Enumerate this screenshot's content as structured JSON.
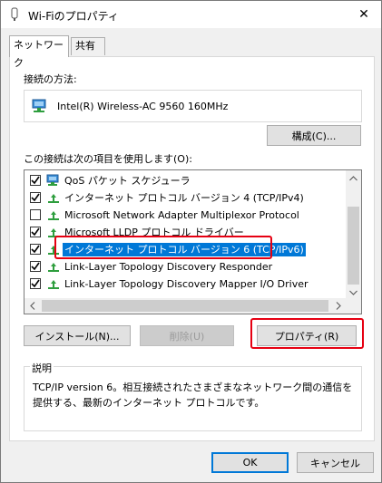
{
  "window": {
    "title": "Wi-Fiのプロパティ",
    "close_glyph": "✕"
  },
  "tabs": [
    {
      "label": "ネットワーク",
      "active": true
    },
    {
      "label": "共有",
      "active": false
    }
  ],
  "connection": {
    "connect_using_label": "接続の方法:",
    "adapter_name": "Intel(R) Wireless-AC 9560 160MHz",
    "configure_button": "構成(C)..."
  },
  "items": {
    "heading": "この接続は次の項目を使用します(O):",
    "list": [
      {
        "label": "QoS パケット スケジューラ",
        "checked": true,
        "icon": "qos-network-icon",
        "selected": false
      },
      {
        "label": "インターネット プロトコル バージョン 4 (TCP/IPv4)",
        "checked": true,
        "icon": "protocol-icon",
        "selected": false
      },
      {
        "label": "Microsoft Network Adapter Multiplexor Protocol",
        "checked": false,
        "icon": "protocol-icon",
        "selected": false
      },
      {
        "label": "Microsoft LLDP プロトコル ドライバー",
        "checked": true,
        "icon": "protocol-icon",
        "selected": false
      },
      {
        "label": "インターネット プロトコル バージョン 6 (TCP/IPv6)",
        "checked": true,
        "icon": "protocol-icon",
        "selected": true
      },
      {
        "label": "Link-Layer Topology Discovery Responder",
        "checked": true,
        "icon": "protocol-icon",
        "selected": false
      },
      {
        "label": "Link-Layer Topology Discovery Mapper I/O Driver",
        "checked": true,
        "icon": "protocol-icon",
        "selected": false
      }
    ]
  },
  "actions": {
    "install": "インストール(N)...",
    "uninstall": "削除(U)",
    "properties": "プロパティ(R)"
  },
  "description": {
    "legend": "説明",
    "text": "TCP/IP version 6。相互接続されたさまざまなネットワーク間の通信を提供する、最新のインターネット プロトコルです。"
  },
  "footer": {
    "ok": "OK",
    "cancel": "キャンセル"
  },
  "colors": {
    "selection": "#0078d7",
    "annotation": "#e60012",
    "protocol_icon": "#2e9e3e"
  }
}
